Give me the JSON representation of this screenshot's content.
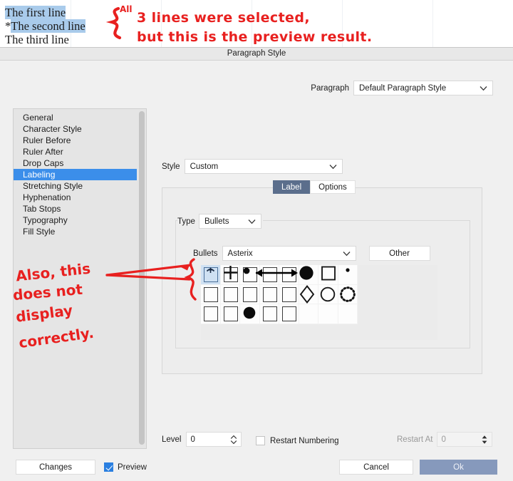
{
  "document_preview": {
    "lines": [
      {
        "text": "The first line",
        "highlighted": true,
        "prefix": ""
      },
      {
        "text": "The second line",
        "highlighted": true,
        "prefix": "*"
      },
      {
        "text": "The third line",
        "highlighted": false,
        "prefix": ""
      }
    ]
  },
  "annotations": {
    "note1_line1": "3 lines were selected,",
    "note1_line2": "but this is the preview result.",
    "note1_all": "All",
    "note2_line1": "Also, this",
    "note2_line2": "does not",
    "note2_line3": "display",
    "note2_line4": "correctly.",
    "ink_color": "#e8201f"
  },
  "dialog": {
    "title": "Paragraph Style",
    "paragraph": {
      "label": "Paragraph",
      "value": "Default Paragraph Style"
    },
    "sidebar": {
      "items": [
        {
          "label": "General",
          "selected": false
        },
        {
          "label": "Character Style",
          "selected": false
        },
        {
          "label": "Ruler Before",
          "selected": false
        },
        {
          "label": "Ruler After",
          "selected": false
        },
        {
          "label": "Drop Caps",
          "selected": false
        },
        {
          "label": "Labeling",
          "selected": true
        },
        {
          "label": "Stretching Style",
          "selected": false
        },
        {
          "label": "Hyphenation",
          "selected": false
        },
        {
          "label": "Tab Stops",
          "selected": false
        },
        {
          "label": "Typography",
          "selected": false
        },
        {
          "label": "Fill Style",
          "selected": false
        }
      ],
      "selected_color": "#3b8eea"
    },
    "style": {
      "label": "Style",
      "value": "Custom"
    },
    "tabs": [
      {
        "label": "Label",
        "active": true
      },
      {
        "label": "Options",
        "active": false
      }
    ],
    "type": {
      "label": "Type",
      "value": "Bullets"
    },
    "bullets": {
      "label": "Bullets",
      "value": "Asterix",
      "other_button": "Other"
    },
    "glyph_grid": {
      "columns": 8,
      "rows": 3,
      "selected_index": 0,
      "selection_color": "#cfe1f3",
      "cells": [
        {
          "index": 0,
          "kind": "box-arrow-up",
          "selected": true
        },
        {
          "index": 1,
          "kind": "plus"
        },
        {
          "index": 2,
          "kind": "small-dot-arrow-left"
        },
        {
          "index": 3,
          "kind": "arrow-line"
        },
        {
          "index": 4,
          "kind": "arrow-right"
        },
        {
          "index": 5,
          "kind": "filled-circle-large"
        },
        {
          "index": 6,
          "kind": "open-square"
        },
        {
          "index": 7,
          "kind": "tiny-dot"
        },
        {
          "index": 8,
          "kind": "box"
        },
        {
          "index": 9,
          "kind": "box"
        },
        {
          "index": 10,
          "kind": "box"
        },
        {
          "index": 11,
          "kind": "box"
        },
        {
          "index": 12,
          "kind": "box"
        },
        {
          "index": 13,
          "kind": "diamond"
        },
        {
          "index": 14,
          "kind": "open-circle"
        },
        {
          "index": 15,
          "kind": "dotted-circle"
        },
        {
          "index": 16,
          "kind": "box"
        },
        {
          "index": 17,
          "kind": "box"
        },
        {
          "index": 18,
          "kind": "filled-circle"
        },
        {
          "index": 19,
          "kind": "box"
        },
        {
          "index": 20,
          "kind": "box"
        },
        {
          "index": 21,
          "kind": "empty"
        },
        {
          "index": 22,
          "kind": "empty"
        },
        {
          "index": 23,
          "kind": "empty"
        }
      ]
    },
    "level": {
      "label": "Level",
      "value": "0"
    },
    "restart_numbering": {
      "label": "Restart Numbering",
      "checked": false
    },
    "restart_at": {
      "label": "Restart At",
      "value": "0",
      "disabled": true
    },
    "footer": {
      "changes": "Changes",
      "preview": {
        "label": "Preview",
        "checked": true
      },
      "cancel": "Cancel",
      "ok": "Ok",
      "ok_color": "#8699bc"
    }
  }
}
